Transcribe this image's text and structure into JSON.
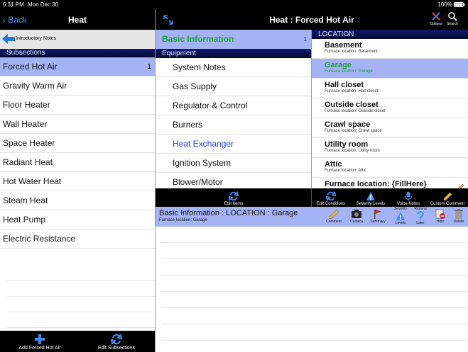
{
  "status": {
    "time": "6:31 PM",
    "date": "Mon Dec 30",
    "battery": "100%"
  },
  "left": {
    "back_label": "Back",
    "title": "Heat",
    "intro_label": "Introductory Notes",
    "subsections_header": "Subsections",
    "items": [
      {
        "label": "Forced Hot Air",
        "count": "1"
      },
      {
        "label": "Gravity Warm Air"
      },
      {
        "label": "Floor Heater"
      },
      {
        "label": "Wall Heater"
      },
      {
        "label": "Space Heater"
      },
      {
        "label": "Radiant Heat"
      },
      {
        "label": "Hot Water Heat"
      },
      {
        "label": "Steam Heat"
      },
      {
        "label": "Heat Pump"
      },
      {
        "label": "Electric Resistance"
      }
    ],
    "add_label": "Add Forced Hot Air",
    "edit_subsections_label": "Edit Subsections"
  },
  "right": {
    "title": "Heat : Forced Hot Air",
    "options_label": "Options",
    "search_label": "Search"
  },
  "mid": {
    "basic_label": "Basic Information",
    "basic_count": "1",
    "equipment_header": "Equipment",
    "items": [
      {
        "label": "System Notes"
      },
      {
        "label": "Gas Supply"
      },
      {
        "label": "Regulator & Control"
      },
      {
        "label": "Burners"
      },
      {
        "label": "Heat Exchanger"
      },
      {
        "label": "Ignition System"
      },
      {
        "label": "Blower/Motor"
      }
    ]
  },
  "location": {
    "header": "LOCATION",
    "items": [
      {
        "title": "Basement",
        "sub": "Furnace location: Basement"
      },
      {
        "title": "Garage",
        "sub": "Furnace location: Garage"
      },
      {
        "title": "Hall closet",
        "sub": "Furnace location: Hall closet"
      },
      {
        "title": "Outside closet",
        "sub": "Furnace location: Outside closet"
      },
      {
        "title": "Crawl space",
        "sub": "Furnace location: Crawl space"
      },
      {
        "title": "Utility room",
        "sub": "Furnace location: Utility room"
      },
      {
        "title": "Attic",
        "sub": "Furnace location: Attic"
      },
      {
        "title": "Furnace location: {FillHere}"
      }
    ]
  },
  "toolbar": {
    "edit_items": "Edit Items",
    "edit_conditions": "Edit Conditions",
    "severity_levels": "Severity Levels",
    "voice_notes": "Voice Notes",
    "custom_comment": "Custom Comment"
  },
  "detail": {
    "title": "Basic Information : LOCATION : Garage",
    "sub": "Furnace location: Garage",
    "tools": {
      "comment": "Comment",
      "camera": "Camera",
      "summary": "Summary",
      "severity": "Severity",
      "levels": "Levels",
      "remind": "Remind",
      "later": "Later",
      "hide": "Hide",
      "delete": "Delete"
    }
  },
  "colors": {
    "selected_bg": "#a4b3f4",
    "header_bg": "#0d1a72",
    "selected_text": "#1ea334",
    "link_blue": "#3d8ef3"
  }
}
